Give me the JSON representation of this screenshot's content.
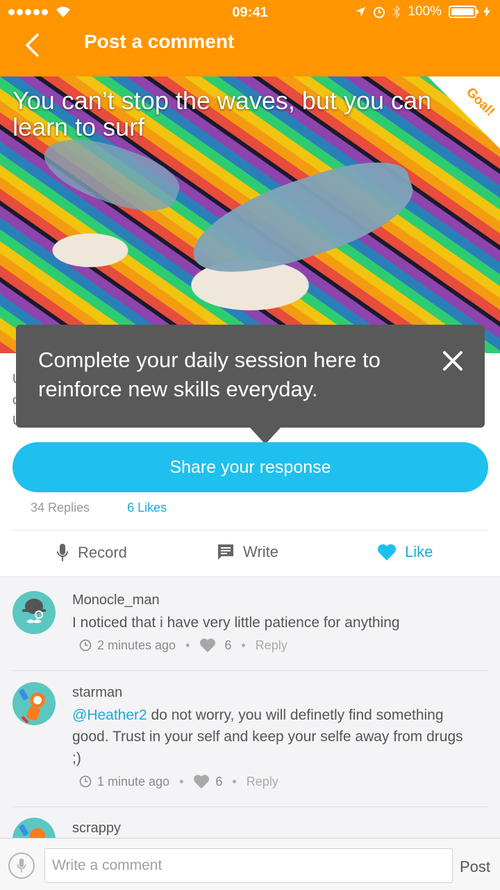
{
  "status": {
    "time": "09:41",
    "battery": "100%"
  },
  "header": {
    "title": "Post a comment"
  },
  "hero": {
    "quote": "You can’t stop the waves, but you can learn to surf",
    "badge": "Goal!"
  },
  "tooltip": {
    "text": "Complete your daily session here to reinforce new skills everyday."
  },
  "share_button": "Share your response",
  "stats": {
    "replies": "34 Replies",
    "likes": "6 Likes"
  },
  "actions": {
    "record": "Record",
    "write": "Write",
    "like": "Like"
  },
  "comments": [
    {
      "user": "Monocle_man",
      "text": "I noticed that i have very little patience for anything",
      "time": "2 minutes ago",
      "likes": "6",
      "reply": "Reply"
    },
    {
      "user": "starman",
      "mention": "@Heather2",
      "text": " do not worry, you will definetly find something good. Trust in your self and keep your selfe away from drugs ;)",
      "time": "1 minute ago",
      "likes": "6",
      "reply": "Reply"
    },
    {
      "user": "scrappy"
    }
  ],
  "composer": {
    "placeholder": "Write a comment",
    "post": "Post"
  },
  "colors": {
    "header": "#ff9500",
    "accent": "#1fc0ed",
    "link": "#1fa8d8",
    "tooltip": "#595959"
  }
}
